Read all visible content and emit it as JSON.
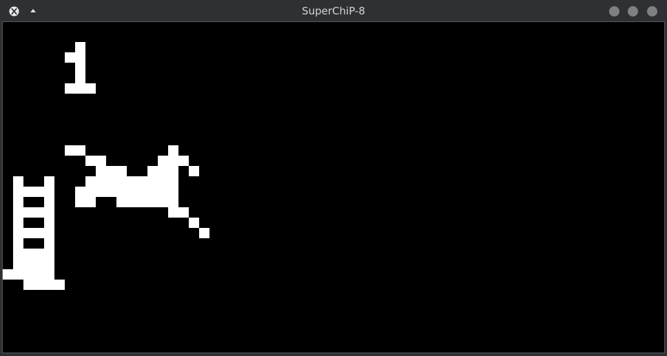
{
  "window": {
    "title": "SuperChiP-8",
    "app_icon": "x-window-icon",
    "menu_icon": "triangle-up-icon",
    "controls": [
      "minimize-button",
      "maximize-button",
      "close-button"
    ]
  },
  "display": {
    "resolution": "128x64",
    "foreground_color": "#ffffff",
    "background_color": "#000000"
  }
}
